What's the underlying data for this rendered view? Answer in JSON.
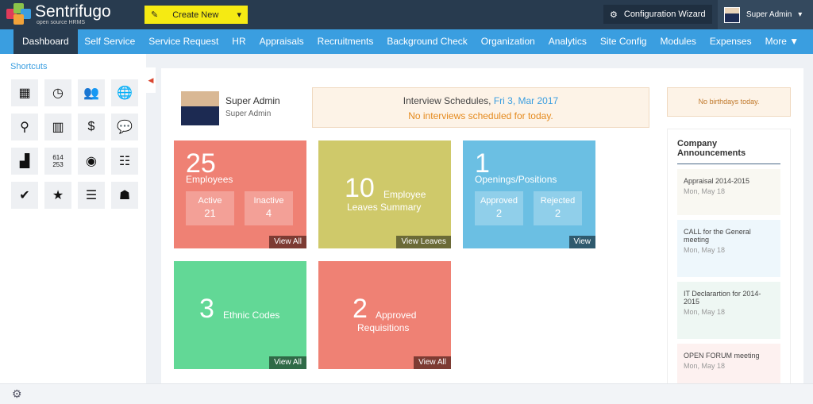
{
  "app": {
    "name": "Sentrifugo",
    "tagline": "open source HRMS"
  },
  "header": {
    "create_new": "Create New",
    "config_wizard": "Configuration Wizard",
    "user": "Super Admin"
  },
  "nav": [
    "Dashboard",
    "Self Service",
    "Service Request",
    "HR",
    "Appraisals",
    "Recruitments",
    "Background Check",
    "Organization",
    "Analytics",
    "Site Config",
    "Modules",
    "Expenses",
    "More ▼"
  ],
  "shortcuts": {
    "title": "Shortcuts",
    "icons": [
      "boxes-icon",
      "clock-icon",
      "users-icon",
      "globe-pin-icon",
      "locations-icon",
      "buildings-icon",
      "coins-icon",
      "chat-icon",
      "stairs-icon",
      "numbers-icon",
      "ring-icon",
      "org-chart-icon",
      "user-check-icon",
      "user-star-icon",
      "user-list-icon",
      "meeting-icon"
    ]
  },
  "profile": {
    "name": "Super Admin",
    "role": "Super Admin"
  },
  "interview": {
    "title": "Interview Schedules,",
    "date": "Fri 3, Mar 2017",
    "message": "No interviews scheduled for today."
  },
  "tiles": {
    "employees": {
      "count": "25",
      "label": "Employees",
      "active_label": "Active",
      "active": "21",
      "inactive_label": "Inactive",
      "inactive": "4",
      "link": "View All",
      "color": "#ef8174"
    },
    "leaves": {
      "count": "10",
      "label1": "Employee",
      "label2": "Leaves Summary",
      "link": "View Leaves",
      "color": "#cfc96a"
    },
    "openings": {
      "count": "1",
      "label": "Openings/Positions",
      "approved_label": "Approved",
      "approved": "2",
      "rejected_label": "Rejected",
      "rejected": "2",
      "link": "View",
      "color": "#6bbfe3"
    },
    "ethnic": {
      "count": "3",
      "label": "Ethnic Codes",
      "link": "View All",
      "color": "#62d896"
    },
    "requisitions": {
      "count": "2",
      "label1": "Approved",
      "label2": "Requisitions",
      "link": "View All",
      "color": "#ef8174"
    }
  },
  "birthdays": "No birthdays today.",
  "announcements": {
    "title": "Company Announcements",
    "items": [
      {
        "title": "Appraisal 2014-2015",
        "date": "Mon, May 18"
      },
      {
        "title": "CALL for the General meeting",
        "date": "Mon, May 18"
      },
      {
        "title": "IT Declarartion for 2014-2015",
        "date": "Mon, May 18"
      },
      {
        "title": "OPEN FORUM meeting",
        "date": "Mon, May 18"
      }
    ]
  }
}
